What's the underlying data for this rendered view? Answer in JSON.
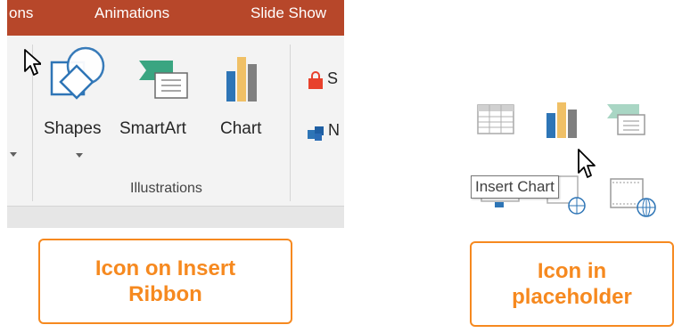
{
  "ribbon": {
    "tabs": [
      "ons",
      "Animations",
      "Slide Show"
    ],
    "commands": {
      "shapes": "Shapes",
      "smartart": "SmartArt",
      "chart": "Chart",
      "store_partial": "S",
      "addins_partial": "N"
    },
    "group_label": "Illustrations"
  },
  "placeholder": {
    "tooltip": "Insert Chart"
  },
  "callouts": {
    "ribbon": "Icon on Insert\nRibbon",
    "placeholder": "Icon in\nplaceholder"
  },
  "colors": {
    "ribbon_tab_bg": "#b7472a",
    "callout_orange": "#f6891f",
    "chart_bar_blue": "#2e75b6",
    "chart_bar_yellow": "#f0c066",
    "chart_bar_gray": "#7f7f7f",
    "smartart_green": "#3aa581"
  },
  "icons": [
    "cursor-arrow-icon",
    "shapes-icon",
    "smartart-icon",
    "chart-icon",
    "store-icon",
    "my-addins-icon",
    "table-icon",
    "video-icon",
    "online-video-icon"
  ]
}
